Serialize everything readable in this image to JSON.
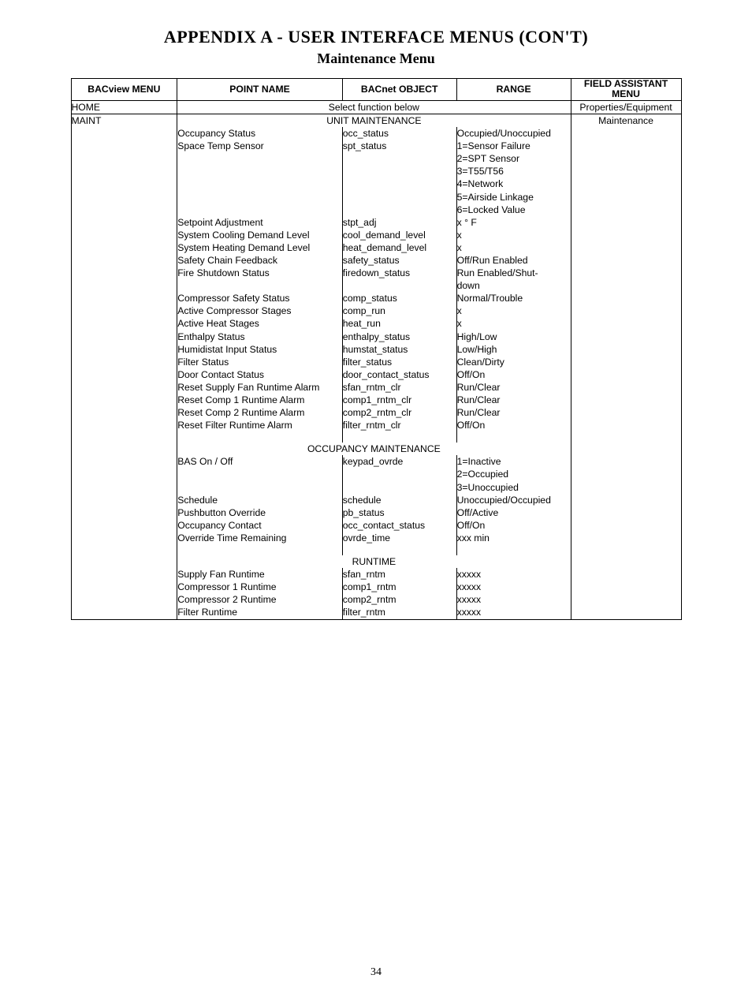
{
  "title": "APPENDIX A - USER INTERFACE MENUS (CON'T)",
  "subtitle": "Maintenance Menu",
  "page_number": "34",
  "headers": {
    "bacview_menu": "BACview MENU",
    "point_name": "POINT NAME",
    "bacnet_object": "BACnet OBJECT",
    "range": "RANGE",
    "field_assistant_l1": "FIELD ASSISTANT",
    "field_assistant_l2": "MENU"
  },
  "home_row": {
    "bacview": "HOME",
    "center_text": "Select function below",
    "fa": "Properties/Equipment"
  },
  "maint": {
    "bacview": "MAINT",
    "unit_section": "UNIT MAINTENANCE",
    "fa": "Maintenance",
    "unit_rows": [
      {
        "point": "Occupancy Status",
        "bacnet": "occ_status",
        "range": "Occupied/Unoccupied"
      },
      {
        "point": "Space Temp Sensor",
        "bacnet": "spt_status",
        "range": "1=Sensor Failure\n2=SPT Sensor\n3=T55/T56\n4=Network\n5=Airside Linkage\n6=Locked Value"
      },
      {
        "point": "Setpoint Adjustment",
        "bacnet": "stpt_adj",
        "range": "x ° F"
      },
      {
        "point": "System Cooling Demand Level",
        "bacnet": "cool_demand_level",
        "range": "x"
      },
      {
        "point": "System Heating Demand Level",
        "bacnet": "heat_demand_level",
        "range": "x"
      },
      {
        "point": "Safety Chain Feedback",
        "bacnet": "safety_status",
        "range": "Off/Run Enabled"
      },
      {
        "point": "Fire Shutdown Status",
        "bacnet": "firedown_status",
        "range": "Run Enabled/Shut-\ndown"
      },
      {
        "point": "Compressor Safety Status",
        "bacnet": "comp_status",
        "range": "Normal/Trouble"
      },
      {
        "point": "Active Compressor Stages",
        "bacnet": "comp_run",
        "range": "x"
      },
      {
        "point": "Active Heat Stages",
        "bacnet": "heat_run",
        "range": "x"
      },
      {
        "point": "Enthalpy Status",
        "bacnet": "enthalpy_status",
        "range": "High/Low"
      },
      {
        "point": "Humidistat Input Status",
        "bacnet": "humstat_status",
        "range": "Low/High"
      },
      {
        "point": "Filter Status",
        "bacnet": "filter_status",
        "range": "Clean/Dirty"
      },
      {
        "point": "Door Contact Status",
        "bacnet": "door_contact_status",
        "range": "Off/On"
      },
      {
        "point": "Reset Supply Fan Runtime Alarm",
        "bacnet": "sfan_rntm_clr",
        "range": "Run/Clear"
      },
      {
        "point": "Reset Comp 1 Runtime Alarm",
        "bacnet": "comp1_rntm_clr",
        "range": "Run/Clear"
      },
      {
        "point": "Reset Comp 2 Runtime Alarm",
        "bacnet": "comp2_rntm_clr",
        "range": "Run/Clear"
      },
      {
        "point": "Reset Filter Runtime Alarm",
        "bacnet": "filter_rntm_clr",
        "range": "Off/On"
      }
    ],
    "occ_section": "OCCUPANCY MAINTENANCE",
    "occ_rows": [
      {
        "point": "BAS On / Off",
        "bacnet": "keypad_ovrde",
        "range": "1=Inactive\n2=Occupied\n3=Unoccupied"
      },
      {
        "point": "Schedule",
        "bacnet": "schedule",
        "range": "Unoccupied/Occupied"
      },
      {
        "point": "Pushbutton Override",
        "bacnet": "pb_status",
        "range": "Off/Active"
      },
      {
        "point": "Occupancy Contact",
        "bacnet": "occ_contact_status",
        "range": "Off/On"
      },
      {
        "point": "Override Time Remaining",
        "bacnet": "ovrde_time",
        "range": "xxx min"
      }
    ],
    "runtime_section": "RUNTIME",
    "runtime_rows": [
      {
        "point": "Supply Fan Runtime",
        "bacnet": "sfan_rntm",
        "range": "xxxxx"
      },
      {
        "point": "Compressor 1 Runtime",
        "bacnet": "comp1_rntm",
        "range": "xxxxx"
      },
      {
        "point": "Compressor 2 Runtime",
        "bacnet": "comp2_rntm",
        "range": "xxxxx"
      },
      {
        "point": "Filter Runtime",
        "bacnet": "filter_rntm",
        "range": "xxxxx"
      }
    ]
  }
}
